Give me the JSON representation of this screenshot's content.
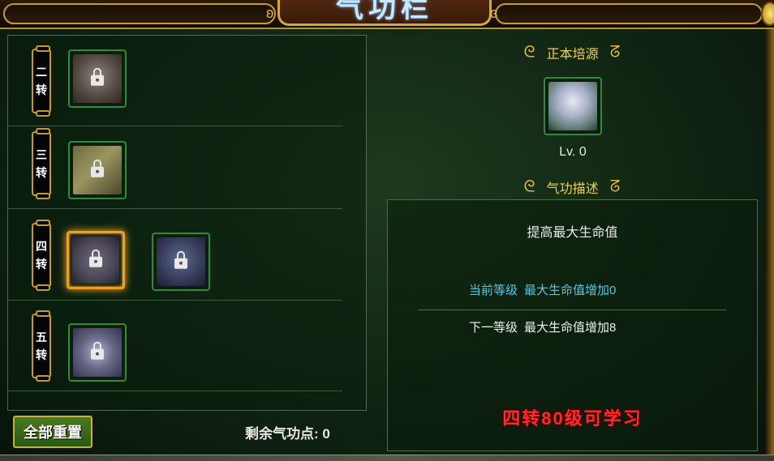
{
  "window": {
    "title": "气功栏"
  },
  "tiers": [
    {
      "label_top": "二",
      "label_bottom": "转"
    },
    {
      "label_top": "三",
      "label_bottom": "转"
    },
    {
      "label_top": "四",
      "label_bottom": "转"
    },
    {
      "label_top": "五",
      "label_bottom": "转"
    }
  ],
  "footer": {
    "reset_button": "全部重置",
    "points_label": "剩余气功点",
    "points_separator": ":",
    "points_value": "0"
  },
  "detail": {
    "skill_name": "正本培源",
    "level": "Lv. 0",
    "desc_title": "气功描述",
    "desc_main": "提高最大生命值",
    "current_label": "当前等级",
    "current_value": "最大生命值增加0",
    "next_label": "下一等级",
    "next_value": "最大生命值增加8",
    "unlock_note": "四转80级可学习"
  },
  "colors": {
    "accent_gold": "#c89a2e",
    "current_stat": "#4ec8e8",
    "unlock_red": "#ff2a2a",
    "selected_border": "#f0a020"
  }
}
